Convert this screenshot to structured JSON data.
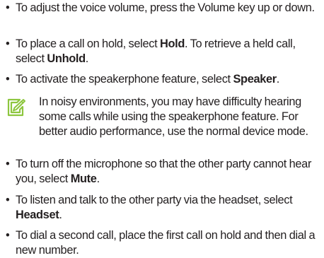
{
  "bullet_glyph": "•",
  "items_top": [
    {
      "text_before": "To adjust the voice volume, press the Volume key up or down.",
      "bold": "",
      "text_after": ""
    },
    {
      "text_before": "To place a call on hold, select ",
      "bold": "Hold",
      "text_after": ". To retrieve a held call, select ",
      "bold2": "Unhold",
      "text_after2": "."
    },
    {
      "text_before": "To activate the speakerphone feature, select ",
      "bold": "Speaker",
      "text_after": "."
    }
  ],
  "note": {
    "icon": "note-pencil-icon",
    "text": "In noisy environments, you may have difficulty hearing some calls while using the speakerphone feature. For better audio performance, use the normal device mode."
  },
  "items_bottom": [
    {
      "text_before": "To turn off the microphone so that the other party cannot hear you, select ",
      "bold": "Mute",
      "text_after": "."
    },
    {
      "text_before": "To listen and talk to the other party via the headset, select ",
      "bold": "Headset",
      "text_after": "."
    },
    {
      "text_before": "To dial a second call, place the first call on hold and then dial a new number.",
      "bold": "",
      "text_after": ""
    }
  ],
  "colors": {
    "text": "#231f20",
    "note_icon": "#8dc63f"
  }
}
